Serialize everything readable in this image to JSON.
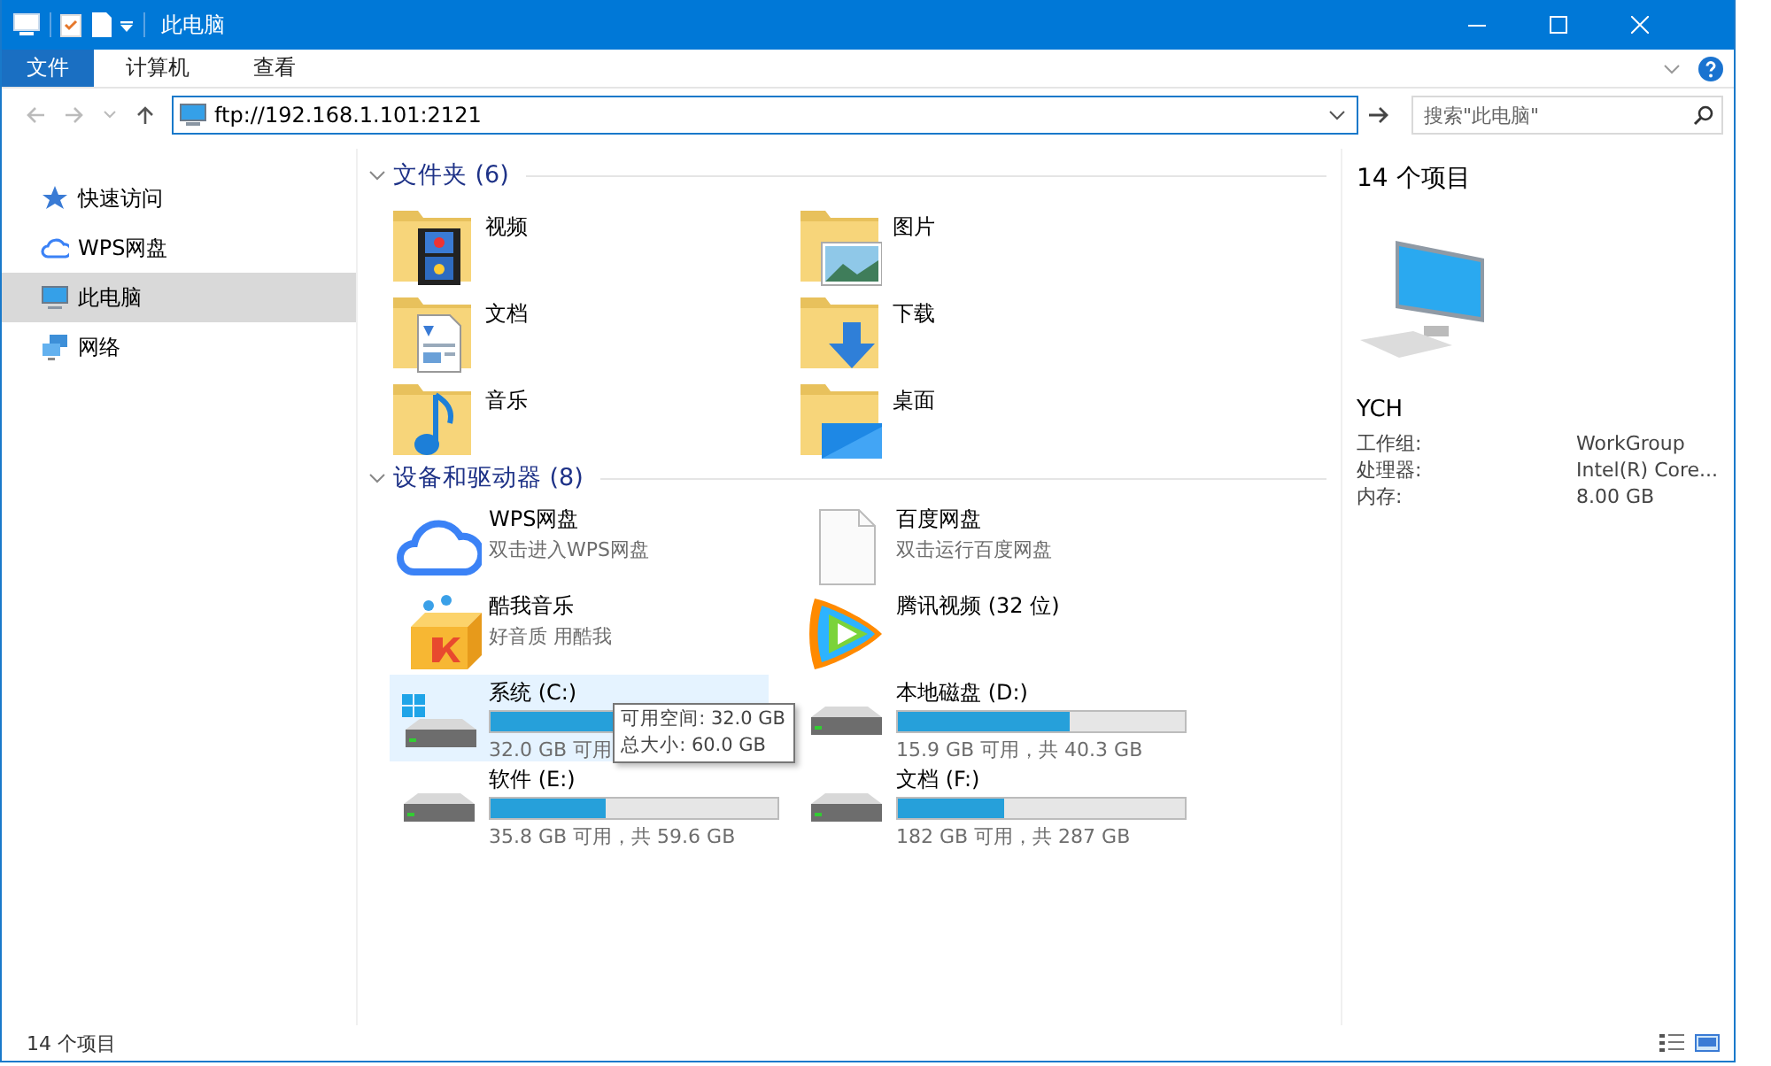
{
  "window": {
    "title": "此电脑"
  },
  "ribbon": {
    "tabs": [
      {
        "label": "文件",
        "kind": "file"
      },
      {
        "label": "计算机",
        "kind": "tab"
      },
      {
        "label": "查看",
        "kind": "tab"
      }
    ]
  },
  "address": {
    "value": "ftp://192.168.1.101:2121"
  },
  "search": {
    "placeholder": "搜索\"此电脑\""
  },
  "sidebar": {
    "items": [
      {
        "label": "快速访问",
        "kind": "star",
        "selected": false
      },
      {
        "label": "WPS网盘",
        "kind": "cloud",
        "selected": false
      },
      {
        "label": "此电脑",
        "kind": "pc",
        "selected": true
      },
      {
        "label": "网络",
        "kind": "network",
        "selected": false
      }
    ]
  },
  "sections": [
    {
      "title": "文件夹 (6)",
      "expanded": true,
      "items": [
        {
          "label": "视频",
          "kind": "video"
        },
        {
          "label": "图片",
          "kind": "pictures"
        },
        {
          "label": "文档",
          "kind": "documents"
        },
        {
          "label": "下载",
          "kind": "downloads"
        },
        {
          "label": "音乐",
          "kind": "music"
        },
        {
          "label": "桌面",
          "kind": "desktop"
        }
      ]
    },
    {
      "title": "设备和驱动器 (8)",
      "expanded": true,
      "items": [
        {
          "label": "WPS网盘",
          "subtitle": "双击进入WPS网盘",
          "kind": "cloud"
        },
        {
          "label": "百度网盘",
          "subtitle": "双击运行百度网盘",
          "kind": "file"
        },
        {
          "label": "酷我音乐",
          "subtitle": "好音质 用酷我",
          "kind": "box"
        },
        {
          "label": "腾讯视频 (32 位)",
          "kind": "play"
        },
        {
          "label": "系统 (C:)",
          "kind": "system-drive",
          "level": 0.47,
          "caption": "32.0 GB 可用",
          "selected": true
        },
        {
          "label": "本地磁盘 (D:)",
          "kind": "drive",
          "level": 0.6,
          "caption": "15.9 GB 可用，共 40.3 GB",
          "selected": false
        },
        {
          "label": "软件 (E:)",
          "kind": "drive",
          "level": 0.4,
          "caption": "35.8 GB 可用，共 59.6 GB",
          "selected": false
        },
        {
          "label": "文档 (F:)",
          "kind": "drive",
          "level": 0.37,
          "caption": "182 GB 可用，共 287 GB",
          "selected": false
        }
      ]
    }
  ],
  "tooltip": {
    "lines": [
      "可用空间: 32.0 GB",
      "总大小: 60.0 GB"
    ]
  },
  "details": {
    "count": "14 个项目",
    "name": "YCH",
    "properties": [
      {
        "label": "工作组:",
        "value": "WorkGroup"
      },
      {
        "label": "处理器:",
        "value": "Intel(R) Core..."
      },
      {
        "label": "内存:",
        "value": "8.00 GB"
      }
    ]
  },
  "status_bar": {
    "count": "14 个项目"
  }
}
